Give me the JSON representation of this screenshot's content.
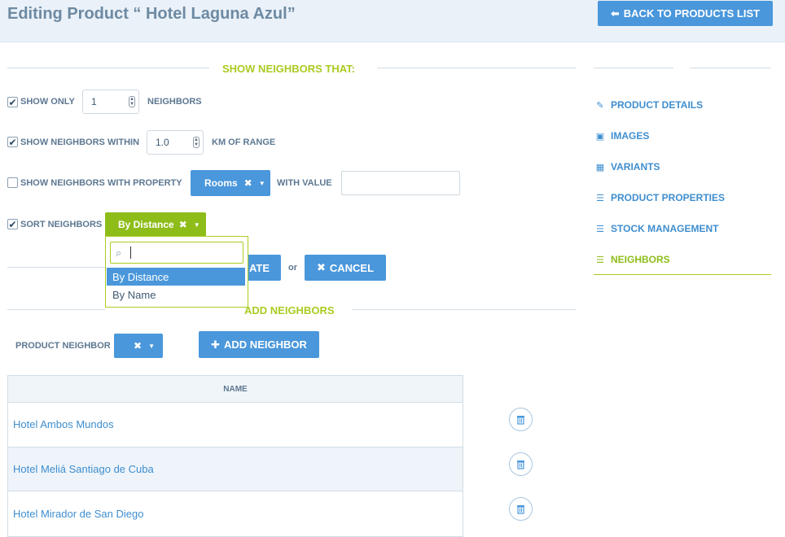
{
  "header": {
    "title": "Editing Product “ Hotel Laguna Azul”",
    "back_button": "BACK TO PRODUCTS LIST"
  },
  "show_neighbors": {
    "title": "SHOW NEIGHBORS THAT:",
    "show_only": {
      "checked": true,
      "label": "SHOW ONLY",
      "value": "1",
      "suffix": "NEIGHBORS"
    },
    "within": {
      "checked": true,
      "label": "SHOW NEIGHBORS WITHIN",
      "value": "1.0",
      "suffix": "KM OF RANGE"
    },
    "with_property": {
      "checked": false,
      "label": "SHOW NEIGHBORS WITH PROPERTY",
      "property": "Rooms",
      "value_label": "WITH VALUE",
      "value": ""
    },
    "sort": {
      "checked": true,
      "label": "SORT NEIGHBORS",
      "selected": "By Distance"
    },
    "sort_dropdown": {
      "search_value": "",
      "options": [
        "By Distance",
        "By Name"
      ],
      "highlighted": "By Distance"
    },
    "update_button": "ATE",
    "or_text": "or",
    "cancel_button": "CANCEL"
  },
  "add_neighbors": {
    "title": "ADD NEIGHBORS",
    "product_neighbor_label": "PRODUCT NEIGHBOR",
    "add_button": "ADD NEIGHBOR"
  },
  "table": {
    "header": "NAME",
    "rows": [
      {
        "name": "Hotel Ambos Mundos"
      },
      {
        "name": "Hotel Meliá Santiago de Cuba"
      },
      {
        "name": "Hotel Mirador de San Diego"
      }
    ]
  },
  "sidebar": {
    "items": [
      {
        "label": "PRODUCT DETAILS",
        "icon": "edit-icon"
      },
      {
        "label": "IMAGES",
        "icon": "image-icon"
      },
      {
        "label": "VARIANTS",
        "icon": "grid-icon"
      },
      {
        "label": "PRODUCT PROPERTIES",
        "icon": "list-icon"
      },
      {
        "label": "STOCK MANAGEMENT",
        "icon": "list-icon"
      },
      {
        "label": "NEIGHBORS",
        "icon": "list-icon",
        "active": true
      }
    ]
  },
  "colors": {
    "primary": "#4a97db",
    "accent": "#a9cc22",
    "header_bg": "#eaf1f8"
  }
}
